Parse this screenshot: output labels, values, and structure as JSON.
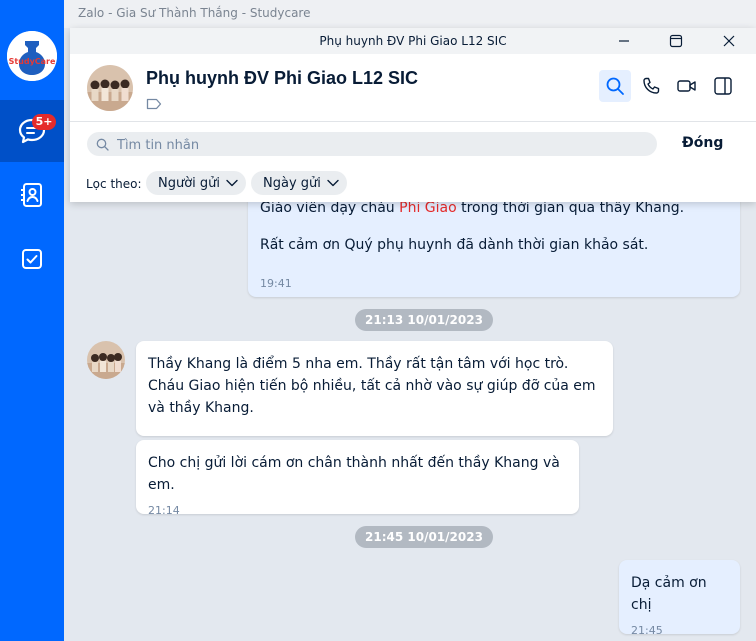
{
  "app": {
    "window_title": "Zalo - Gia Sư Thành Thắng - Studycare"
  },
  "sidebar": {
    "logo_text": "StudyCare",
    "badge": "5+",
    "items": [
      {
        "icon": "message-icon",
        "active": true
      },
      {
        "icon": "contacts-icon",
        "active": false
      },
      {
        "icon": "todo-check-icon",
        "active": false
      }
    ]
  },
  "popup": {
    "title": "Phụ huynh ĐV Phi Giao L12 SIC",
    "conversation_name": "Phụ huynh ĐV Phi Giao L12 SIC",
    "search_placeholder": "Tìm tin nhắn",
    "close_label": "Đóng",
    "filter_label": "Lọc theo:",
    "filters": [
      "Người gửi",
      "Ngày gửi"
    ]
  },
  "messages": {
    "top_bubble": {
      "partial_text_a": "Giáo viên dạy cháu ",
      "partial_highlight": "Phi Giao",
      "partial_text_b": " trong thời gian qua thầy Khang.",
      "text": "Rất cảm ơn Quý phụ huynh đã dành thời gian khảo sát.",
      "time": "19:41"
    },
    "date_1": "21:13 10/01/2023",
    "incoming_1": "Thầy Khang là điểm 5 nha em. Thầy rất tận tâm với học trò. Cháu Giao hiện tiến bộ nhiều, tất cả nhờ vào sự giúp đỡ của em và thầy Khang.",
    "incoming_2": "Cho chị gửi lời cám ơn chân thành nhất đến thầy Khang và em.",
    "incoming_2_time": "21:14",
    "date_2": "21:45 10/01/2023",
    "outgoing": "Dạ cảm ơn chị",
    "outgoing_time": "21:45"
  },
  "colors": {
    "accent": "#0068ff",
    "sidebar_active": "#0050c8",
    "badge": "#e52b2b",
    "own_bubble": "#e5efff",
    "highlight_text": "#e52b2b"
  }
}
